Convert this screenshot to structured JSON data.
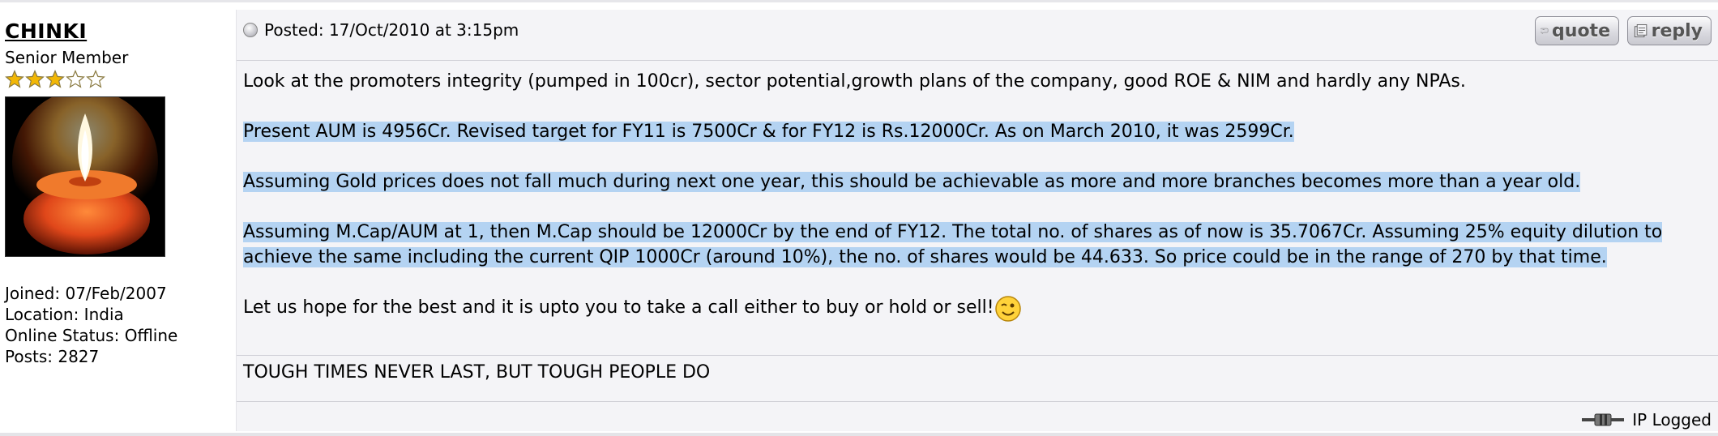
{
  "user": {
    "name": "CHINKI",
    "rank": "Senior Member",
    "stars": 5,
    "filled_stars": 3,
    "joined": "Joined: 07/Feb/2007",
    "location": "Location: India",
    "online_status": "Online Status: Offline",
    "posts": "Posts: 2827"
  },
  "post": {
    "posted": "Posted: 17/Oct/2010 at 3:15pm",
    "quote_label": "quote",
    "reply_label": "reply",
    "paragraphs": [
      "Look at the promoters integrity (pumped in 100cr), sector potential,growth plans of the company, good ROE & NIM and hardly any NPAs.",
      "Present AUM is 4956Cr. Revised target for FY11 is 7500Cr & for FY12 is Rs.12000Cr. As on March 2010, it was 2599Cr. ",
      "Assuming Gold prices does not fall much during next one year, this should be achievable as more and more branches becomes more than a year old.",
      "Assuming M.Cap/AUM at 1, then M.Cap should be 12000Cr by the end of FY12. The total no. of shares as of now is 35.7067Cr. Assuming 25% equity dilution to achieve the same including the current QIP 1000Cr (around 10%), the no. of shares would be 44.633. So price could be in the range of 270 by that time. ",
      "Let us hope for the best and it is upto you to take a call either to buy or hold or sell!"
    ],
    "signature": "TOUGH TIMES NEVER LAST, BUT TOUGH PEOPLE DO",
    "ip_logged": "IP Logged"
  },
  "colors": {
    "highlight": "#b4d3f2",
    "content_bg": "#f4f4f7",
    "star_filled": "#f2b705"
  },
  "icons": [
    "star-icon",
    "avatar-candle",
    "post-bullet-icon",
    "quote-icon",
    "reply-icon",
    "wink-smiley-icon",
    "ip-logged-icon"
  ]
}
